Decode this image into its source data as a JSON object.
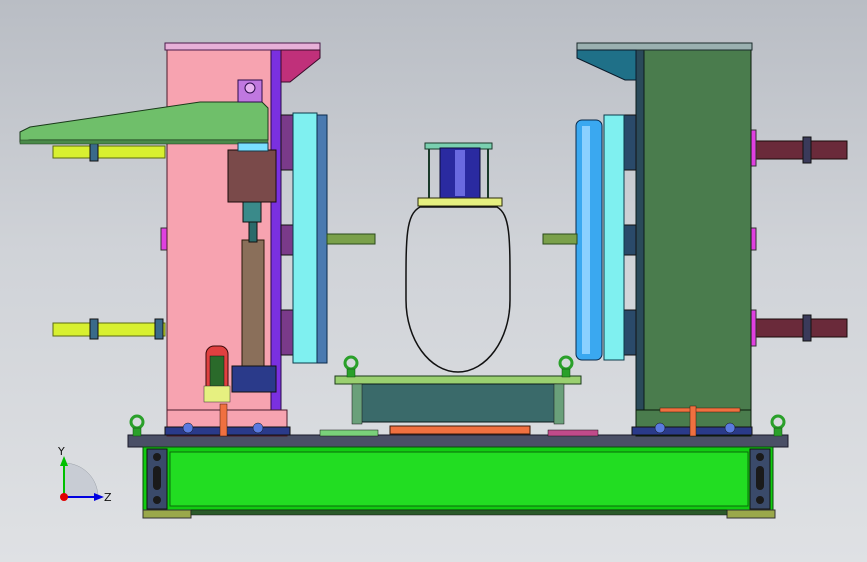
{
  "view": {
    "background_top": "#b9bdc4",
    "background_bottom": "#dfe1e4"
  },
  "triad": {
    "y_label": "Y",
    "z_label": "Z",
    "y_color": "#00c000",
    "z_color": "#0000e0",
    "x_color": "#e00000"
  },
  "colors": {
    "left_housing": "#f7a3b0",
    "right_housing": "#4a7c4d",
    "left_arm": "#6fbf6a",
    "left_top_wedge": "#c0307a",
    "right_top_wedge": "#1f7088",
    "cyan_plate": "#7ff0f0",
    "blue_roller": "#3aa8f0",
    "base_beam": "#11cc11",
    "yellow_shaft": "#d8f030",
    "maroon_shaft": "#6a2a3a",
    "cylinder": "#8a6f5a",
    "coil": "#2a2aa0",
    "steel": "#4a6a70",
    "eyebolt": "#2aa02a"
  }
}
